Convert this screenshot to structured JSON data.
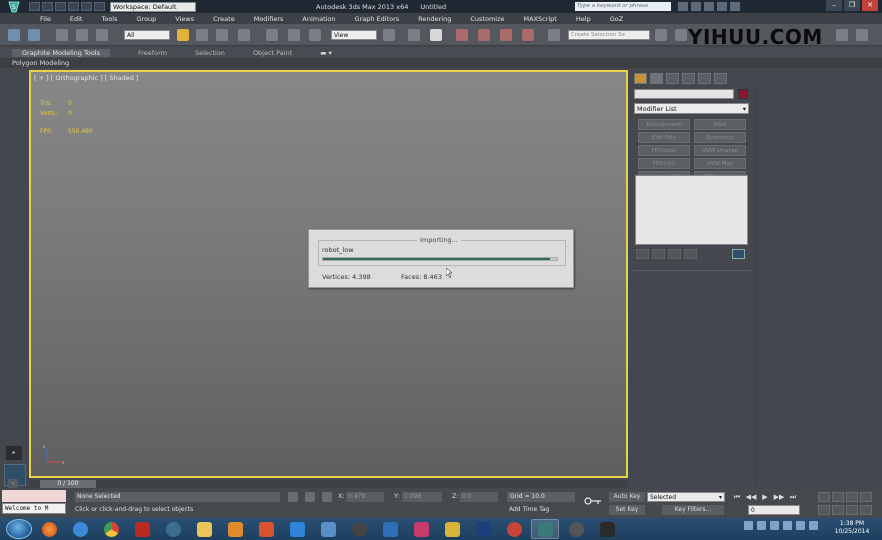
{
  "titlebar": {
    "workspace": "Workspace: Default",
    "app_title": "Autodesk 3ds Max  2013 x64",
    "document": "Untitled",
    "search_placeholder": "Type a keyword or phrase"
  },
  "menu": [
    "File",
    "Edit",
    "Tools",
    "Group",
    "Views",
    "Create",
    "Modifiers",
    "Animation",
    "Graph Editors",
    "Rendering",
    "Customize",
    "MAXScript",
    "Help",
    "GoZ"
  ],
  "toolbar": {
    "selection_filter": "All",
    "reference_coord": "View",
    "selection_set_placeholder": "Create Selection Se"
  },
  "watermark": "YIHUU.COM",
  "ribbon": {
    "tabs": [
      "Graphite Modeling Tools",
      "Freeform",
      "Selection",
      "Object Paint"
    ],
    "sub_label": "Polygon Modeling"
  },
  "viewport": {
    "label": "[ + ] [ Orthographic ] [ Shaded ]",
    "stats": [
      {
        "label": "Tris:",
        "value": "0"
      },
      {
        "label": "Verts:",
        "value": "0"
      }
    ],
    "fps_label": "FPS:",
    "fps_value": "550.480"
  },
  "import_dialog": {
    "title": "Importing...",
    "filename": "robot_low",
    "progress": 0.97,
    "vertices": "Vertices: 4.398",
    "faces": "Faces: 8.463"
  },
  "command_panel": {
    "modifier_list": "Modifier List",
    "modifier_buttons": [
      "TurboSmooth",
      "Shell",
      "Edit Poly",
      "Symmetry",
      "FFD(box)",
      "UVW Unwrap",
      "FFD(cyl)",
      "UVW Map",
      "Unwrap UVW",
      "FFDselect..."
    ],
    "color_swatch": "#8a1630"
  },
  "timeline": {
    "frame_label": "0 / 100"
  },
  "status": {
    "welcome": "Welcome to M",
    "selection": "None Selected",
    "prompt": "Click or click-and-drag to select objects",
    "x_label": "X:",
    "x_value": "0.479",
    "y_label": "Y:",
    "y_value": "1.098",
    "z_label": "Z:",
    "z_value": "0.0",
    "grid": "Grid = 10.0",
    "add_time_tag": "Add Time Tag",
    "auto_key": "Auto Key",
    "set_key": "Set Key",
    "key_mode": "Selected",
    "key_filters": "Key Filters...",
    "frame_value": "0"
  },
  "taskbar": {
    "clock_time": "1:38 PM",
    "clock_date": "10/25/2014"
  }
}
